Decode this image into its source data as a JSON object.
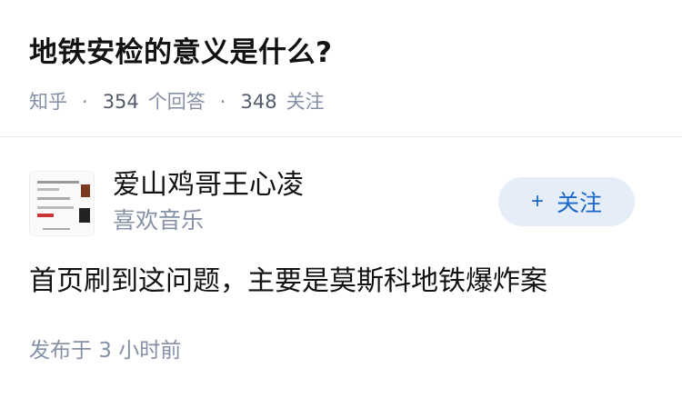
{
  "question": {
    "title": "地铁安检的意义是什么?",
    "source": "知乎",
    "answers_count": "354",
    "answers_label": "个回答",
    "followers_count": "348",
    "followers_label": "关注"
  },
  "author": {
    "name": "爱山鸡哥王心凌",
    "bio": "喜欢音乐",
    "avatar_icon": "avatar-image"
  },
  "follow_button": {
    "icon": "plus",
    "label": "关注",
    "accent": "#1a66c9",
    "background": "#e5eef8"
  },
  "answer": {
    "text": "首页刷到这问题，主要是莫斯科地铁爆炸案",
    "published": "发布于 3 小时前"
  }
}
